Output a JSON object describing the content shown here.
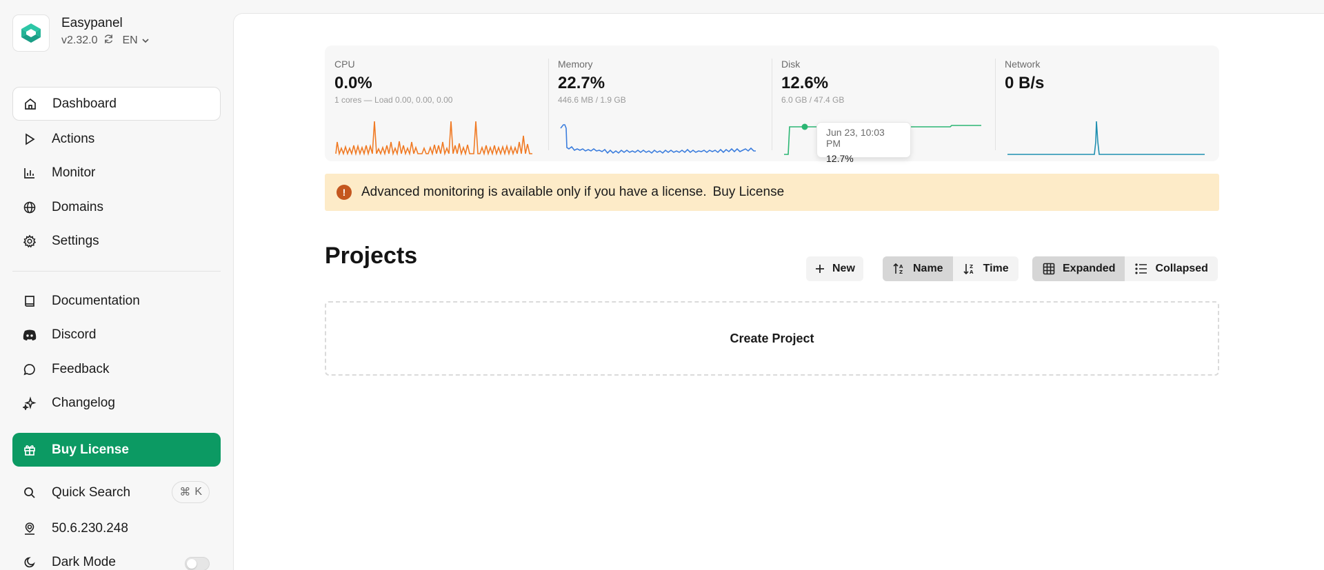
{
  "brand": {
    "name": "Easypanel",
    "version": "v2.32.0",
    "language": "EN"
  },
  "nav": {
    "dashboard": "Dashboard",
    "actions": "Actions",
    "monitor": "Monitor",
    "domains": "Domains",
    "settings": "Settings",
    "documentation": "Documentation",
    "discord": "Discord",
    "feedback": "Feedback",
    "changelog": "Changelog",
    "buy_license": "Buy License",
    "quick_search": "Quick Search",
    "quick_search_shortcut_key": "K",
    "server_ip": "50.6.230.248",
    "dark_mode": "Dark Mode"
  },
  "stats": {
    "cpu": {
      "label": "CPU",
      "value": "0.0%",
      "sub": "1 cores — Load 0.00, 0.00, 0.00",
      "color": "#f07a24"
    },
    "memory": {
      "label": "Memory",
      "value": "22.7%",
      "sub": "446.6 MB / 1.9 GB",
      "color": "#3b7ddd"
    },
    "disk": {
      "label": "Disk",
      "value": "12.6%",
      "sub": "6.0 GB / 47.4 GB",
      "color": "#2bb673"
    },
    "network": {
      "label": "Network",
      "value": "0 B/s",
      "color": "#1f8fb0"
    }
  },
  "tooltip": {
    "time": "Jun 23, 10:03 PM",
    "value": "12.7%"
  },
  "alert": {
    "message": "Advanced monitoring is available only if you have a license.",
    "link": "Buy License"
  },
  "projects": {
    "title": "Projects",
    "new_label": "New",
    "sort_name": "Name",
    "sort_time": "Time",
    "view_expanded": "Expanded",
    "view_collapsed": "Collapsed",
    "create_label": "Create Project"
  },
  "colors": {
    "accent": "#0c9a63",
    "alert_bg": "#fdebc8",
    "alert_icon": "#c4571f"
  }
}
